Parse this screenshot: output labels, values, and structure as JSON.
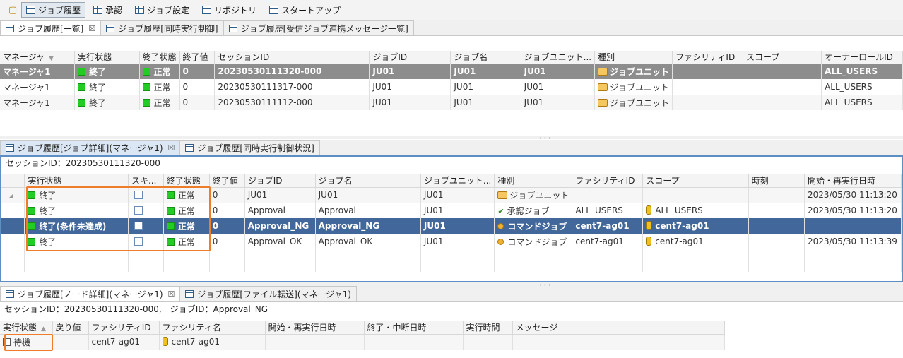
{
  "toolbar": {
    "items": [
      "ジョブ履歴",
      "承認",
      "ジョブ設定",
      "リポジトリ",
      "スタートアップ"
    ]
  },
  "top_tabs": [
    {
      "label": "ジョブ履歴[一覧]",
      "close": "☒"
    },
    {
      "label": "ジョブ履歴[同時実行制御]"
    },
    {
      "label": "ジョブ履歴[受信ジョブ連携メッセージ一覧]"
    }
  ],
  "history_table": {
    "headers": [
      "マネージャ",
      "実行状態",
      "終了状態",
      "終了値",
      "セッションID",
      "ジョブID",
      "ジョブ名",
      "ジョブユニット...",
      "種別",
      "ファシリティID",
      "スコープ",
      "オーナーロールID"
    ],
    "rows": [
      {
        "manager": "マネージャ1",
        "run_state": "終了",
        "end_state": "正常",
        "end_value": "0",
        "session_id": "20230530111320-000",
        "job_id": "JU01",
        "job_name": "JU01",
        "jobunit": "JU01",
        "type": "ジョブユニット",
        "facility": "",
        "scope": "",
        "owner": "ALL_USERS"
      },
      {
        "manager": "マネージャ1",
        "run_state": "終了",
        "end_state": "正常",
        "end_value": "0",
        "session_id": "20230530111317-000",
        "job_id": "JU01",
        "job_name": "JU01",
        "jobunit": "JU01",
        "type": "ジョブユニット",
        "facility": "",
        "scope": "",
        "owner": "ALL_USERS"
      },
      {
        "manager": "マネージャ1",
        "run_state": "終了",
        "end_state": "正常",
        "end_value": "0",
        "session_id": "20230530111112-000",
        "job_id": "JU01",
        "job_name": "JU01",
        "jobunit": "JU01",
        "type": "ジョブユニット",
        "facility": "",
        "scope": "",
        "owner": "ALL_USERS"
      }
    ]
  },
  "mid_tabs": [
    {
      "label": "ジョブ履歴[ジョブ詳細](マネージャ1)",
      "close": "☒"
    },
    {
      "label": "ジョブ履歴[同時実行制御状況]"
    }
  ],
  "detail": {
    "session_line": "セッションID：20230530111320-000",
    "headers": [
      "",
      "実行状態",
      "スキ...",
      "終了状態",
      "終了値",
      "ジョブID",
      "ジョブ名",
      "ジョブユニット...",
      "種別",
      "ファシリティID",
      "スコープ",
      "時刻",
      "開始・再実行日時"
    ],
    "rows": [
      {
        "run_state": "終了",
        "end_state": "正常",
        "end_value": "0",
        "job_id": "JU01",
        "job_name": "JU01",
        "jobunit": "JU01",
        "type": "ジョブユニット",
        "facility": "",
        "scope": "",
        "time": "",
        "start": "2023/05/30 11:13:20"
      },
      {
        "run_state": "終了",
        "end_state": "正常",
        "end_value": "0",
        "job_id": "Approval",
        "job_name": "Approval",
        "jobunit": "JU01",
        "type": "承認ジョブ",
        "facility": "ALL_USERS",
        "scope": "ALL_USERS",
        "time": "",
        "start": "2023/05/30 11:13:20"
      },
      {
        "run_state": "終了(条件未達成)",
        "end_state": "正常",
        "end_value": "0",
        "job_id": "Approval_NG",
        "job_name": "Approval_NG",
        "jobunit": "JU01",
        "type": "コマンドジョブ",
        "facility": "cent7-ag01",
        "scope": "cent7-ag01",
        "time": "",
        "start": ""
      },
      {
        "run_state": "終了",
        "end_state": "正常",
        "end_value": "0",
        "job_id": "Approval_OK",
        "job_name": "Approval_OK",
        "jobunit": "JU01",
        "type": "コマンドジョブ",
        "facility": "cent7-ag01",
        "scope": "cent7-ag01",
        "time": "",
        "start": "2023/05/30 11:13:39"
      }
    ]
  },
  "bottom_tabs": [
    {
      "label": "ジョブ履歴[ノード詳細](マネージャ1)",
      "close": "☒"
    },
    {
      "label": "ジョブ履歴[ファイル転送](マネージャ1)"
    }
  ],
  "node": {
    "session_line": "セッションID：20230530111320-000,　ジョブID：Approval_NG",
    "headers": [
      "実行状態",
      "戻り値",
      "ファシリティID",
      "ファシリティ名",
      "開始・再実行日時",
      "終了・中断日時",
      "実行時間",
      "メッセージ"
    ],
    "rows": [
      {
        "run_state": "待機",
        "return": "",
        "facility": "cent7-ag01",
        "facility_name": "cent7-ag01",
        "start": "",
        "end": "",
        "duration": "",
        "message": ""
      }
    ]
  },
  "colors": {
    "status_green": "#22cc22",
    "highlight_orange": "#ee7d2a",
    "selection_blue": "#42679a",
    "selection_gray": "#8d8d8d"
  }
}
